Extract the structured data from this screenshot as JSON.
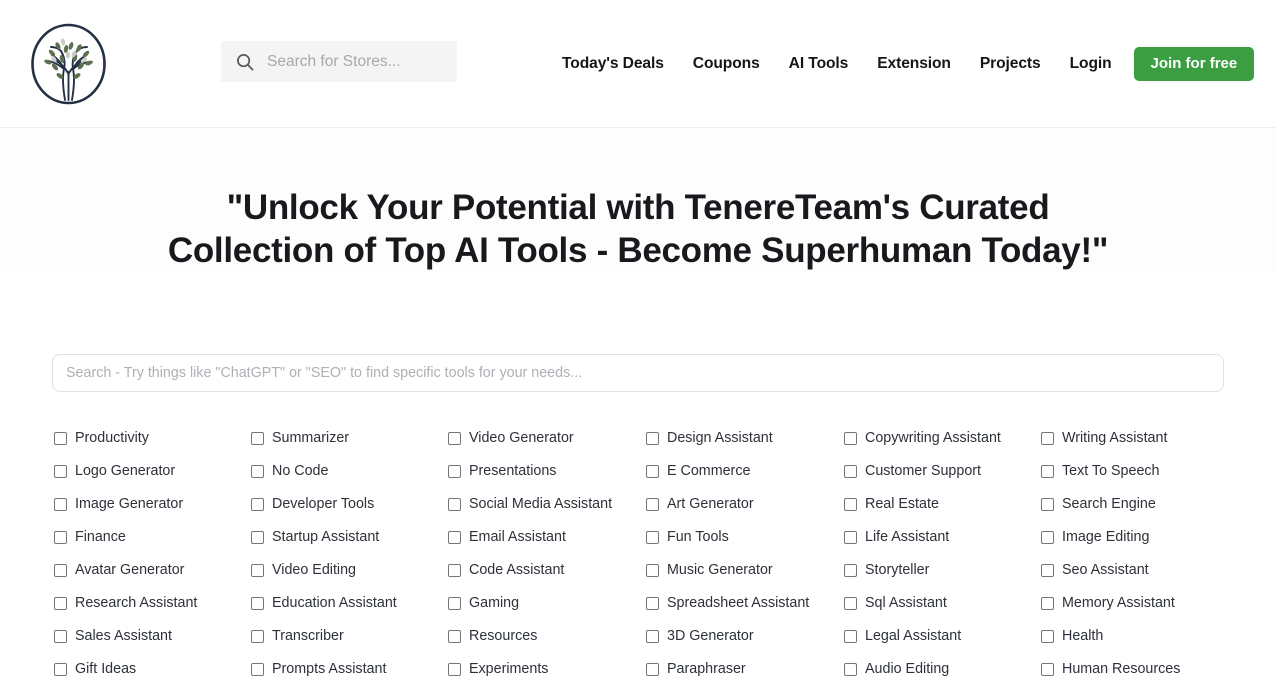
{
  "header": {
    "logo_name": "tenereteam-tree-logo",
    "search": {
      "placeholder": "Search for Stores...",
      "value": "",
      "icon": "search-icon"
    },
    "nav": [
      {
        "label": "Today's Deals"
      },
      {
        "label": "Coupons"
      },
      {
        "label": "AI Tools"
      },
      {
        "label": "Extension"
      },
      {
        "label": "Projects"
      },
      {
        "label": "Login"
      }
    ],
    "cta": {
      "label": "Join for free",
      "color": "#3b9e41"
    }
  },
  "hero": {
    "title": "\"Unlock Your Potential with TenereTeam's Curated Collection of Top AI Tools - Become Superhuman Today!\""
  },
  "main_search": {
    "placeholder": "Search - Try things like \"ChatGPT\" or \"SEO\" to find specific tools for your needs...",
    "value": ""
  },
  "categories": [
    "Productivity",
    "Summarizer",
    "Video Generator",
    "Design Assistant",
    "Copywriting Assistant",
    "Writing Assistant",
    "Logo Generator",
    "No Code",
    "Presentations",
    "E Commerce",
    "Customer Support",
    "Text To Speech",
    "Image Generator",
    "Developer Tools",
    "Social Media Assistant",
    "Art Generator",
    "Real Estate",
    "Search Engine",
    "Finance",
    "Startup Assistant",
    "Email Assistant",
    "Fun Tools",
    "Life Assistant",
    "Image Editing",
    "Avatar Generator",
    "Video Editing",
    "Code Assistant",
    "Music Generator",
    "Storyteller",
    "Seo Assistant",
    "Research Assistant",
    "Education Assistant",
    "Gaming",
    "Spreadsheet Assistant",
    "Sql Assistant",
    "Memory Assistant",
    "Sales Assistant",
    "Transcriber",
    "Resources",
    "3D Generator",
    "Legal Assistant",
    "Health",
    "Gift Ideas",
    "Prompts Assistant",
    "Experiments",
    "Paraphraser",
    "Audio Editing",
    "Human Resources"
  ]
}
